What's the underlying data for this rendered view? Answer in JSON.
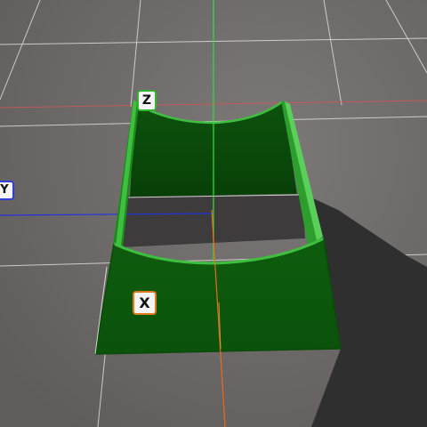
{
  "viewport": {
    "background_color": "#6b6867",
    "grid_color": "#d6d6d6",
    "model_color": "#0f5a0f",
    "model_edge_color": "#3fbf3f",
    "shadow_color": "#2f2f2f"
  },
  "axes": {
    "z": {
      "label": "Z",
      "line_color": "#36d836",
      "tag_border": "#2fb52f"
    },
    "y": {
      "label": "Y",
      "line_color": "#2233dd",
      "tag_border": "#2f3fd8"
    },
    "x": {
      "label": "X",
      "line_color": "#e86a1a",
      "tag_border": "#e07a18"
    }
  }
}
